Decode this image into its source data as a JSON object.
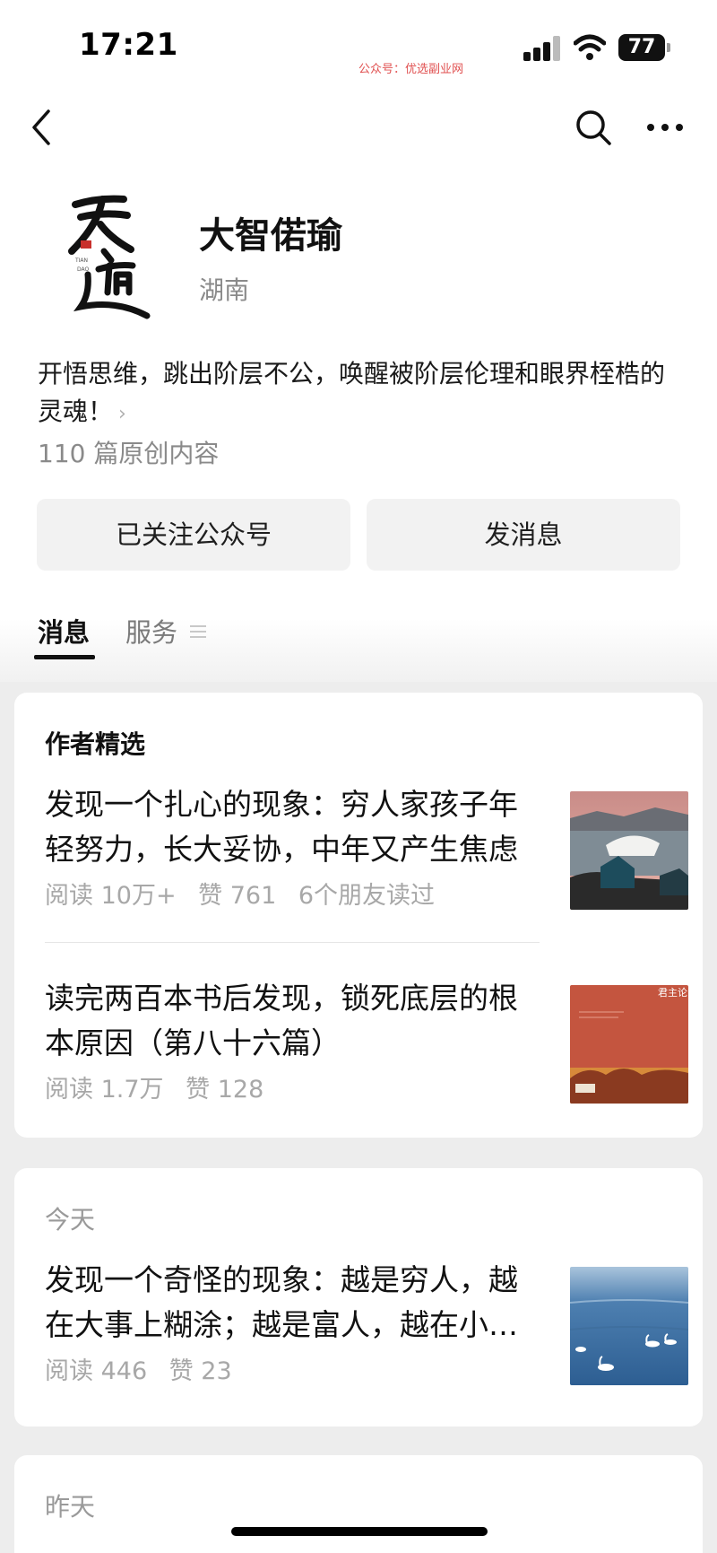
{
  "status_bar": {
    "time": "17:21",
    "watermark": "公众号：优选副业网",
    "battery": "77"
  },
  "profile": {
    "name": "大智偌瑜",
    "location": "湖南",
    "description": "开悟思维，跳出阶层不公，唤醒被阶层伦理和眼界桎梏的灵魂！",
    "description_chevron": "›",
    "original_count": "110 篇原创内容"
  },
  "actions": {
    "follow_label": "已关注公众号",
    "message_label": "发消息"
  },
  "tabs": [
    {
      "label": "消息"
    },
    {
      "label": "服务"
    }
  ],
  "featured": {
    "label": "作者精选",
    "articles": [
      {
        "title": "发现一个扎心的现象：穷人家孩子年轻努力，长大妥协，中年又产生焦虑",
        "reads": "阅读 10万+",
        "likes": "赞 761",
        "friends": "6个朋友读过"
      },
      {
        "title": "读完两百本书后发现，锁死底层的根本原因（第八十六篇）",
        "reads": "阅读 1.7万",
        "likes": "赞 128",
        "thumb_text": "君主论"
      }
    ]
  },
  "today": {
    "label": "今天",
    "articles": [
      {
        "title": "发现一个奇怪的现象：越是穷人，越在大事上糊涂；越是富人，越在小事上较真",
        "reads": "阅读 446",
        "likes": "赞 23"
      }
    ]
  },
  "yesterday": {
    "label": "昨天"
  },
  "icons": {
    "back": "back-icon",
    "search": "search-icon",
    "more": "more-icon",
    "tab_menu": "menu-icon"
  },
  "colors": {
    "background": "#ededed",
    "card": "#ffffff",
    "button": "#f2f2f2",
    "muted": "#a8a8a8",
    "watermark": "#e05050"
  }
}
